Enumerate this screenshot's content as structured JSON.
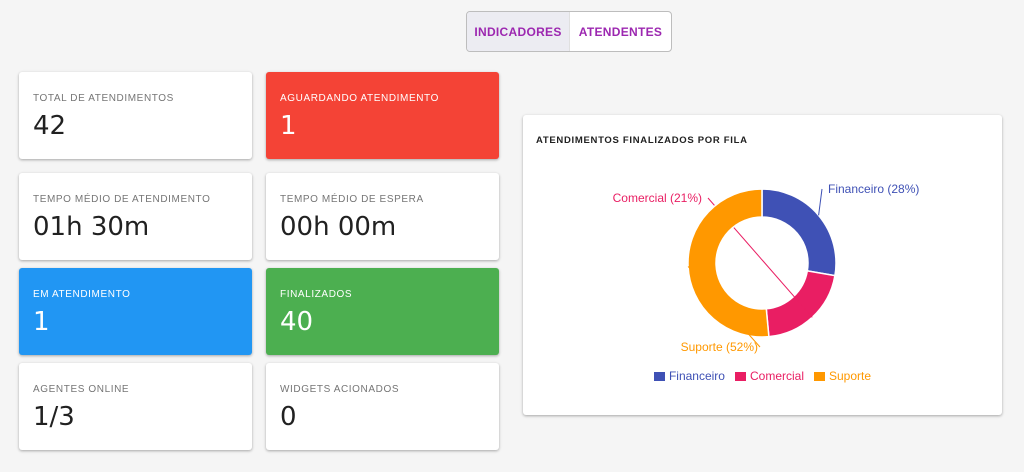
{
  "tabs": [
    {
      "label": "INDICADORES"
    },
    {
      "label": "ATENDENTES"
    }
  ],
  "cards": [
    {
      "label": "TOTAL DE ATENDIMENTOS",
      "value": "42"
    },
    {
      "label": "AGUARDANDO ATENDIMENTO",
      "value": "1",
      "color": "#f44336"
    },
    {
      "label": "TEMPO MÉDIO DE ATENDIMENTO",
      "value": "01h 30m"
    },
    {
      "label": "TEMPO MÉDIO DE ESPERA",
      "value": "00h 00m"
    },
    {
      "label": "EM ATENDIMENTO",
      "value": "1",
      "color": "#2196f3"
    },
    {
      "label": "FINALIZADOS",
      "value": "40",
      "color": "#4caf50"
    },
    {
      "label": "AGENTES ONLINE",
      "value": "1/3"
    },
    {
      "label": "WIDGETS ACIONADOS",
      "value": "0"
    }
  ],
  "chart_data": {
    "type": "pie",
    "title": "ATENDIMENTOS FINALIZADOS POR FILA",
    "categories": [
      "Financeiro",
      "Comercial",
      "Suporte"
    ],
    "values": [
      28,
      21,
      52
    ],
    "labels": [
      "Financeiro (28%)",
      "Comercial (21%)",
      "Suporte (52%)"
    ],
    "colors": [
      "#3f51b5",
      "#e91e63",
      "#ff9800"
    ],
    "donut": true,
    "legend": "bottom"
  }
}
